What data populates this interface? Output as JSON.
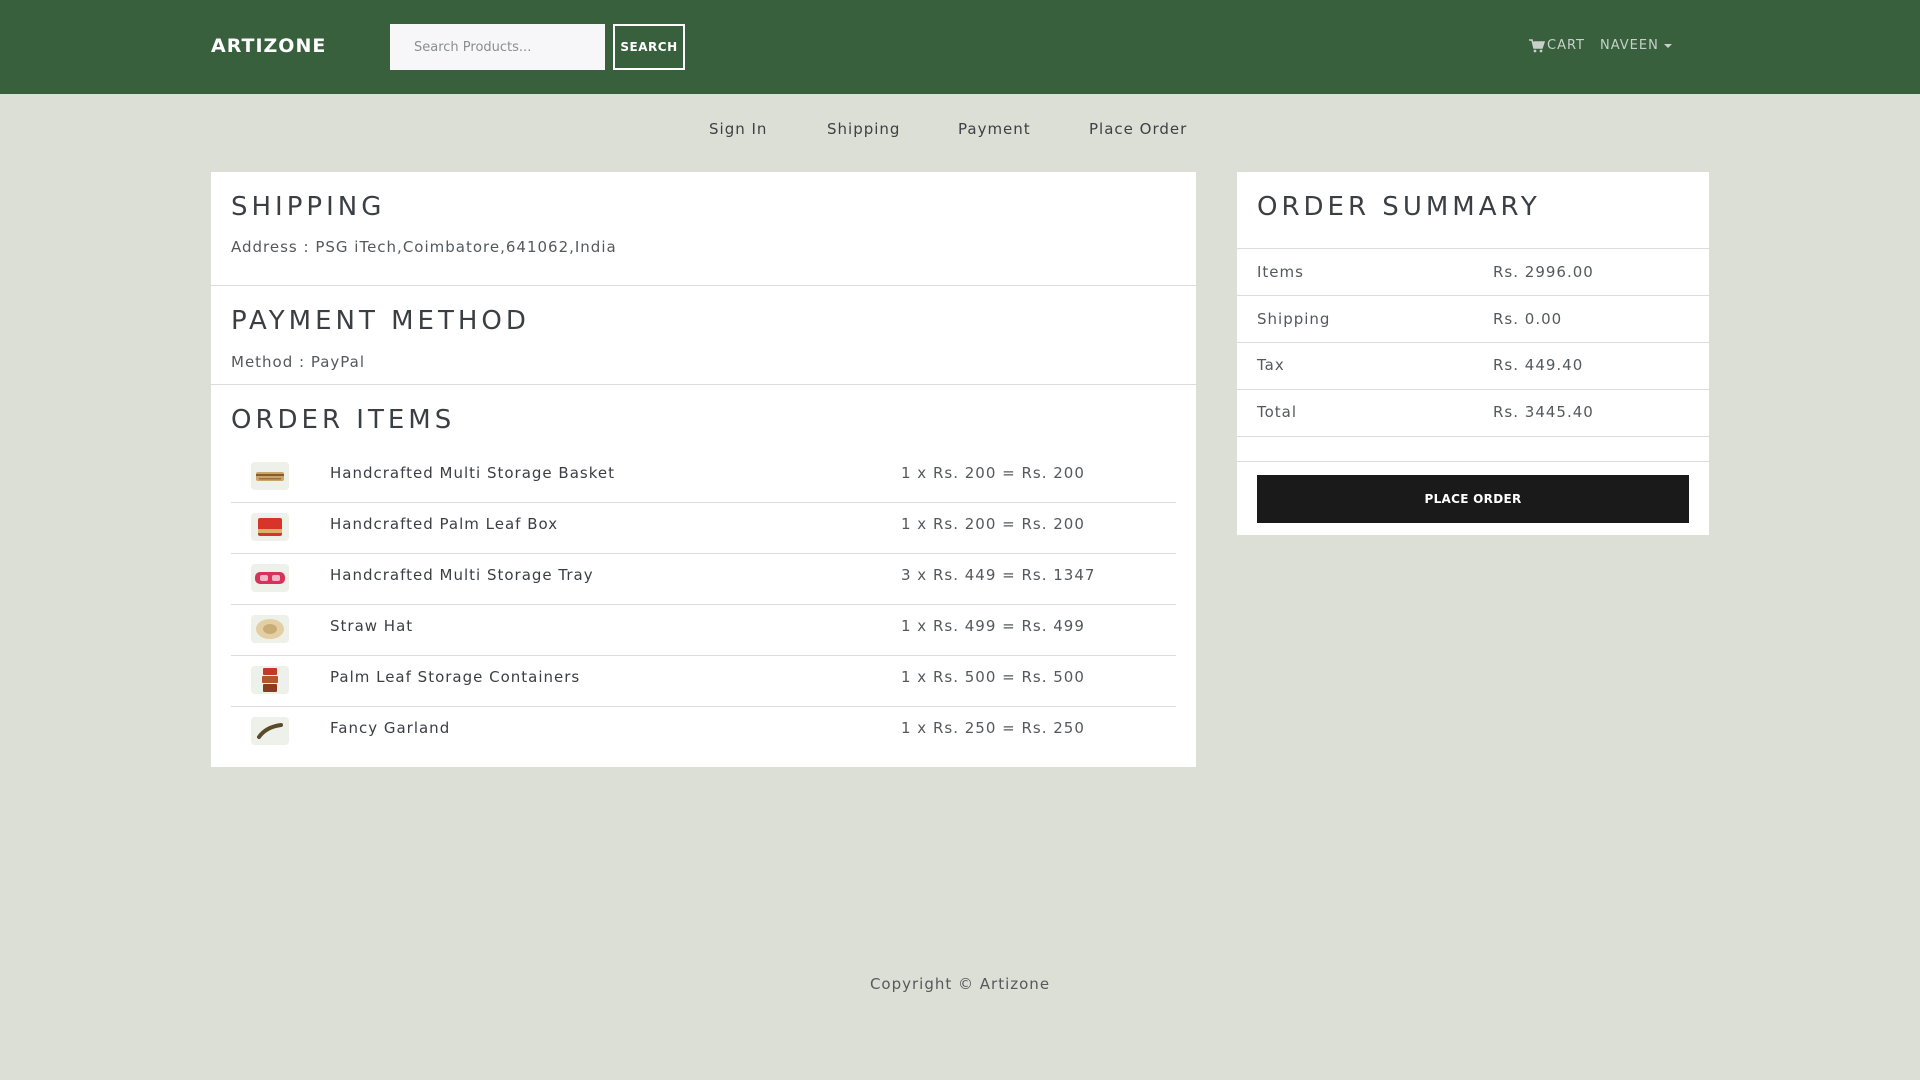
{
  "header": {
    "brand": "ARTIZONE",
    "search_placeholder": "Search Products...",
    "search_button": "SEARCH",
    "cart_label": "CART",
    "user_label": "NAVEEN",
    "bg_color": "#38603d"
  },
  "steps": [
    "Sign In",
    "Shipping",
    "Payment",
    "Place Order"
  ],
  "shipping": {
    "title": "SHIPPING",
    "address": "Address : PSG iTech,Coimbatore,641062,India"
  },
  "payment": {
    "title": "PAYMENT METHOD",
    "method": "Method : PayPal"
  },
  "order_items": {
    "title": "ORDER ITEMS",
    "items": [
      {
        "name": "Handcrafted Multi Storage Basket",
        "price": "1 x Rs. 200 = Rs. 200",
        "icon": "basket-thumbnail"
      },
      {
        "name": "Handcrafted Palm Leaf Box",
        "price": "1 x Rs. 200 = Rs. 200",
        "icon": "box-thumbnail"
      },
      {
        "name": "Handcrafted Multi Storage Tray",
        "price": "3 x Rs. 449 = Rs. 1347",
        "icon": "tray-thumbnail"
      },
      {
        "name": "Straw Hat",
        "price": "1 x Rs. 499 = Rs. 499",
        "icon": "hat-thumbnail"
      },
      {
        "name": "Palm Leaf Storage Containers",
        "price": "1 x Rs. 500 = Rs. 500",
        "icon": "containers-thumbnail"
      },
      {
        "name": "Fancy Garland",
        "price": "1 x Rs. 250 = Rs. 250",
        "icon": "garland-thumbnail"
      }
    ]
  },
  "summary": {
    "title": "ORDER SUMMARY",
    "rows": [
      {
        "label": "Items",
        "value": "Rs. 2996.00"
      },
      {
        "label": "Shipping",
        "value": "Rs. 0.00"
      },
      {
        "label": "Tax",
        "value": "Rs. 449.40"
      },
      {
        "label": "Total",
        "value": "Rs. 3445.40"
      }
    ],
    "button": "PLACE ORDER"
  },
  "footer": "Copyright © Artizone"
}
